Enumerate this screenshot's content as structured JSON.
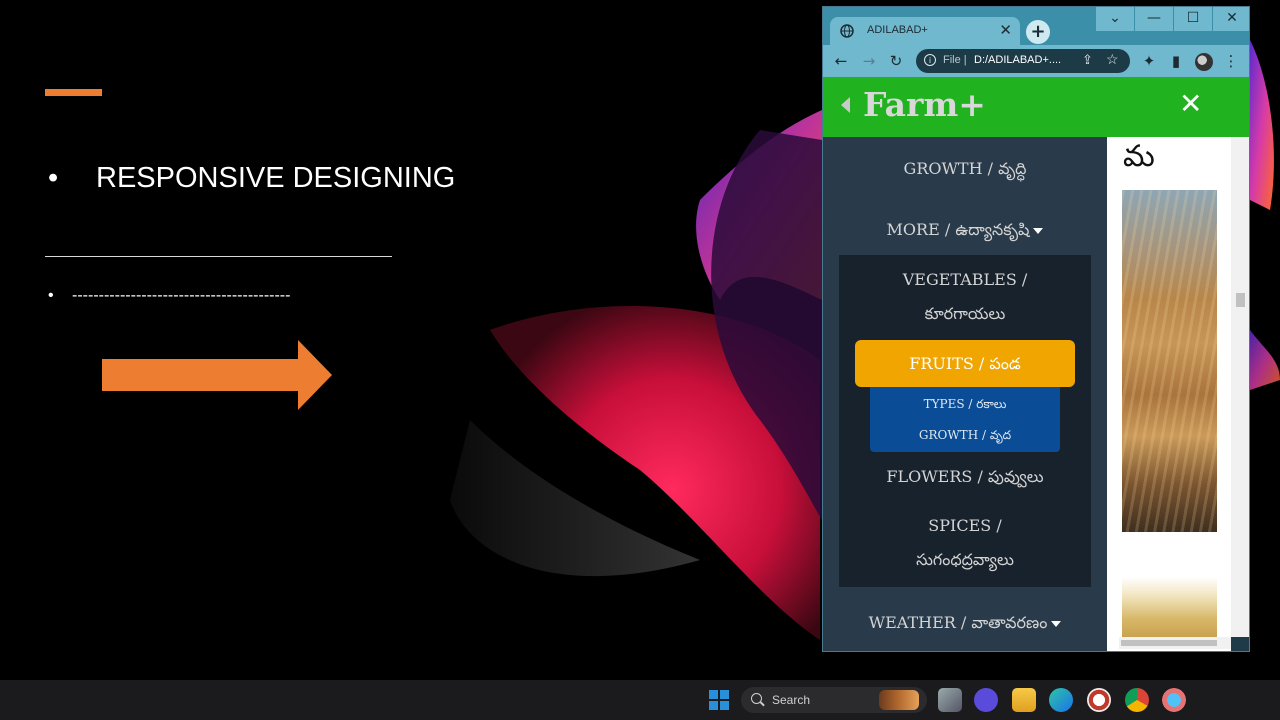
{
  "slide": {
    "bullet_main_symbol": "•",
    "bullet_main": "RESPONSIVE DESIGNING",
    "bullet_dash_symbol": "•",
    "bullet_dash": "-----------------------------------------",
    "colors": {
      "accent": "#ed7d31",
      "background": "#000000"
    }
  },
  "browser": {
    "tab_title": "ADILABAD+",
    "tab_close_glyph": "✕",
    "new_tab_glyph": "+",
    "window_controls": {
      "collapse": "⌄",
      "minimize": "—",
      "maximize": "☐",
      "close": "✕"
    },
    "toolbar": {
      "back": "←",
      "forward": "→",
      "reload": "↻",
      "extensions": "✦",
      "sidepanel": "▮",
      "menu": "⋮"
    },
    "omnibox": {
      "info_glyph": "i",
      "scheme": "File |",
      "url": "D:/ADILABAD+....",
      "share_glyph": "⇪",
      "star_glyph": "☆"
    }
  },
  "page": {
    "brand": "Farm+",
    "close_glyph": "✕",
    "header_color": "#20b21f",
    "menu": {
      "growth": "GROWTH / వృద్ధి",
      "more": "MORE / ఉద్యానకృషి",
      "weather": "WEATHER / వాతావరణం"
    },
    "submenu": {
      "vegetables_line1": "VEGETABLES /",
      "vegetables_line2": "కూరగాయలు",
      "fruits": "FRUITS / పండ",
      "types": "TYPES / రకాలు",
      "growth": "GROWTH / వృద",
      "flowers": "FLOWERS / పువ్వులు",
      "spices_line1": "SPICES /",
      "spices_line2": "సుగంధద్రవ్యాలు"
    },
    "content_glyph": "మ",
    "fruits_color": "#f0a500",
    "types_color": "#0a4c95"
  },
  "taskbar": {
    "search_label": "Search"
  }
}
